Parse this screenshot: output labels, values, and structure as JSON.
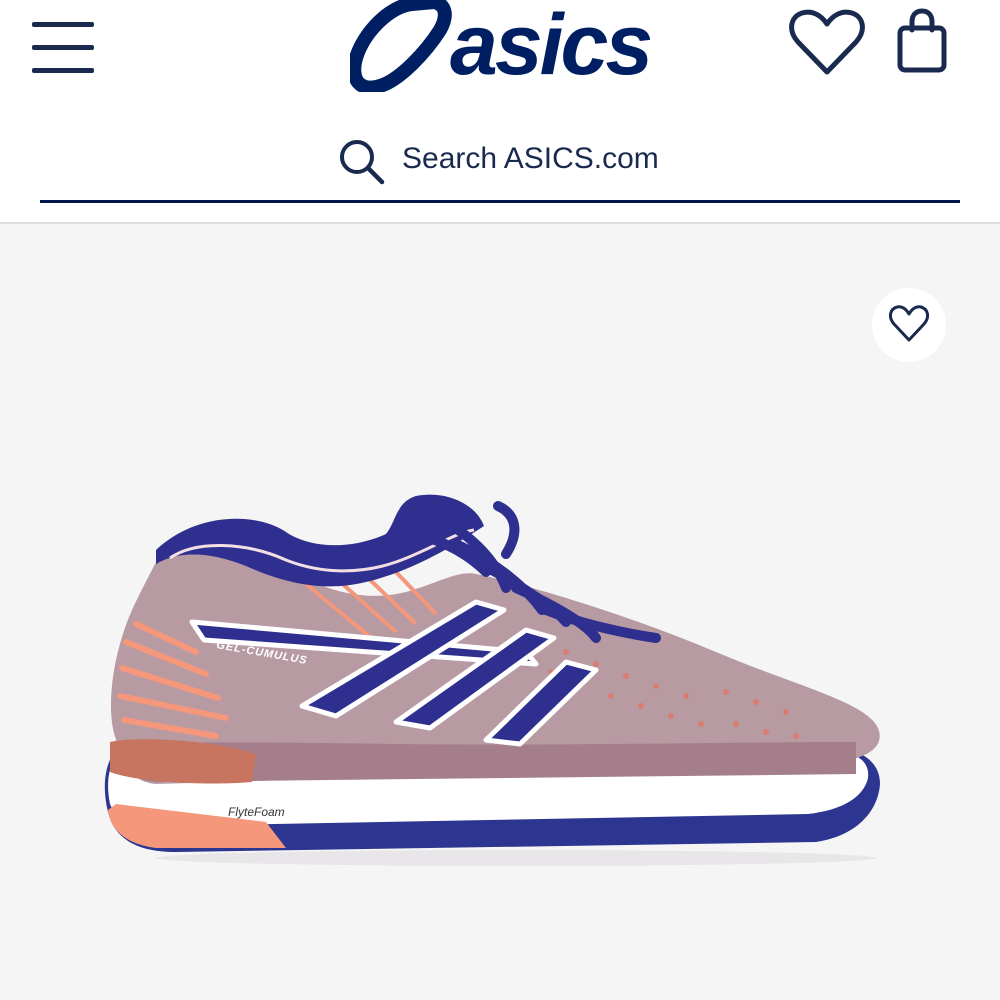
{
  "header": {
    "menu_icon": "hamburger-menu-icon",
    "logo_text": "asics",
    "wishlist_icon": "heart-icon",
    "bag_icon": "shopping-bag-icon"
  },
  "search": {
    "icon": "search-icon",
    "placeholder": "Search ASICS.com"
  },
  "product": {
    "favorite_icon": "heart-icon",
    "shoe_model_label": "GEL-CUMULUS",
    "midsole_label": "FlyteFoam"
  },
  "colors": {
    "brand_navy": "#001e62",
    "page_background": "#f5f5f5",
    "shoe_upper": "#b89aa3",
    "shoe_accent_navy": "#2f2f8f",
    "shoe_accent_coral": "#f4977a"
  }
}
